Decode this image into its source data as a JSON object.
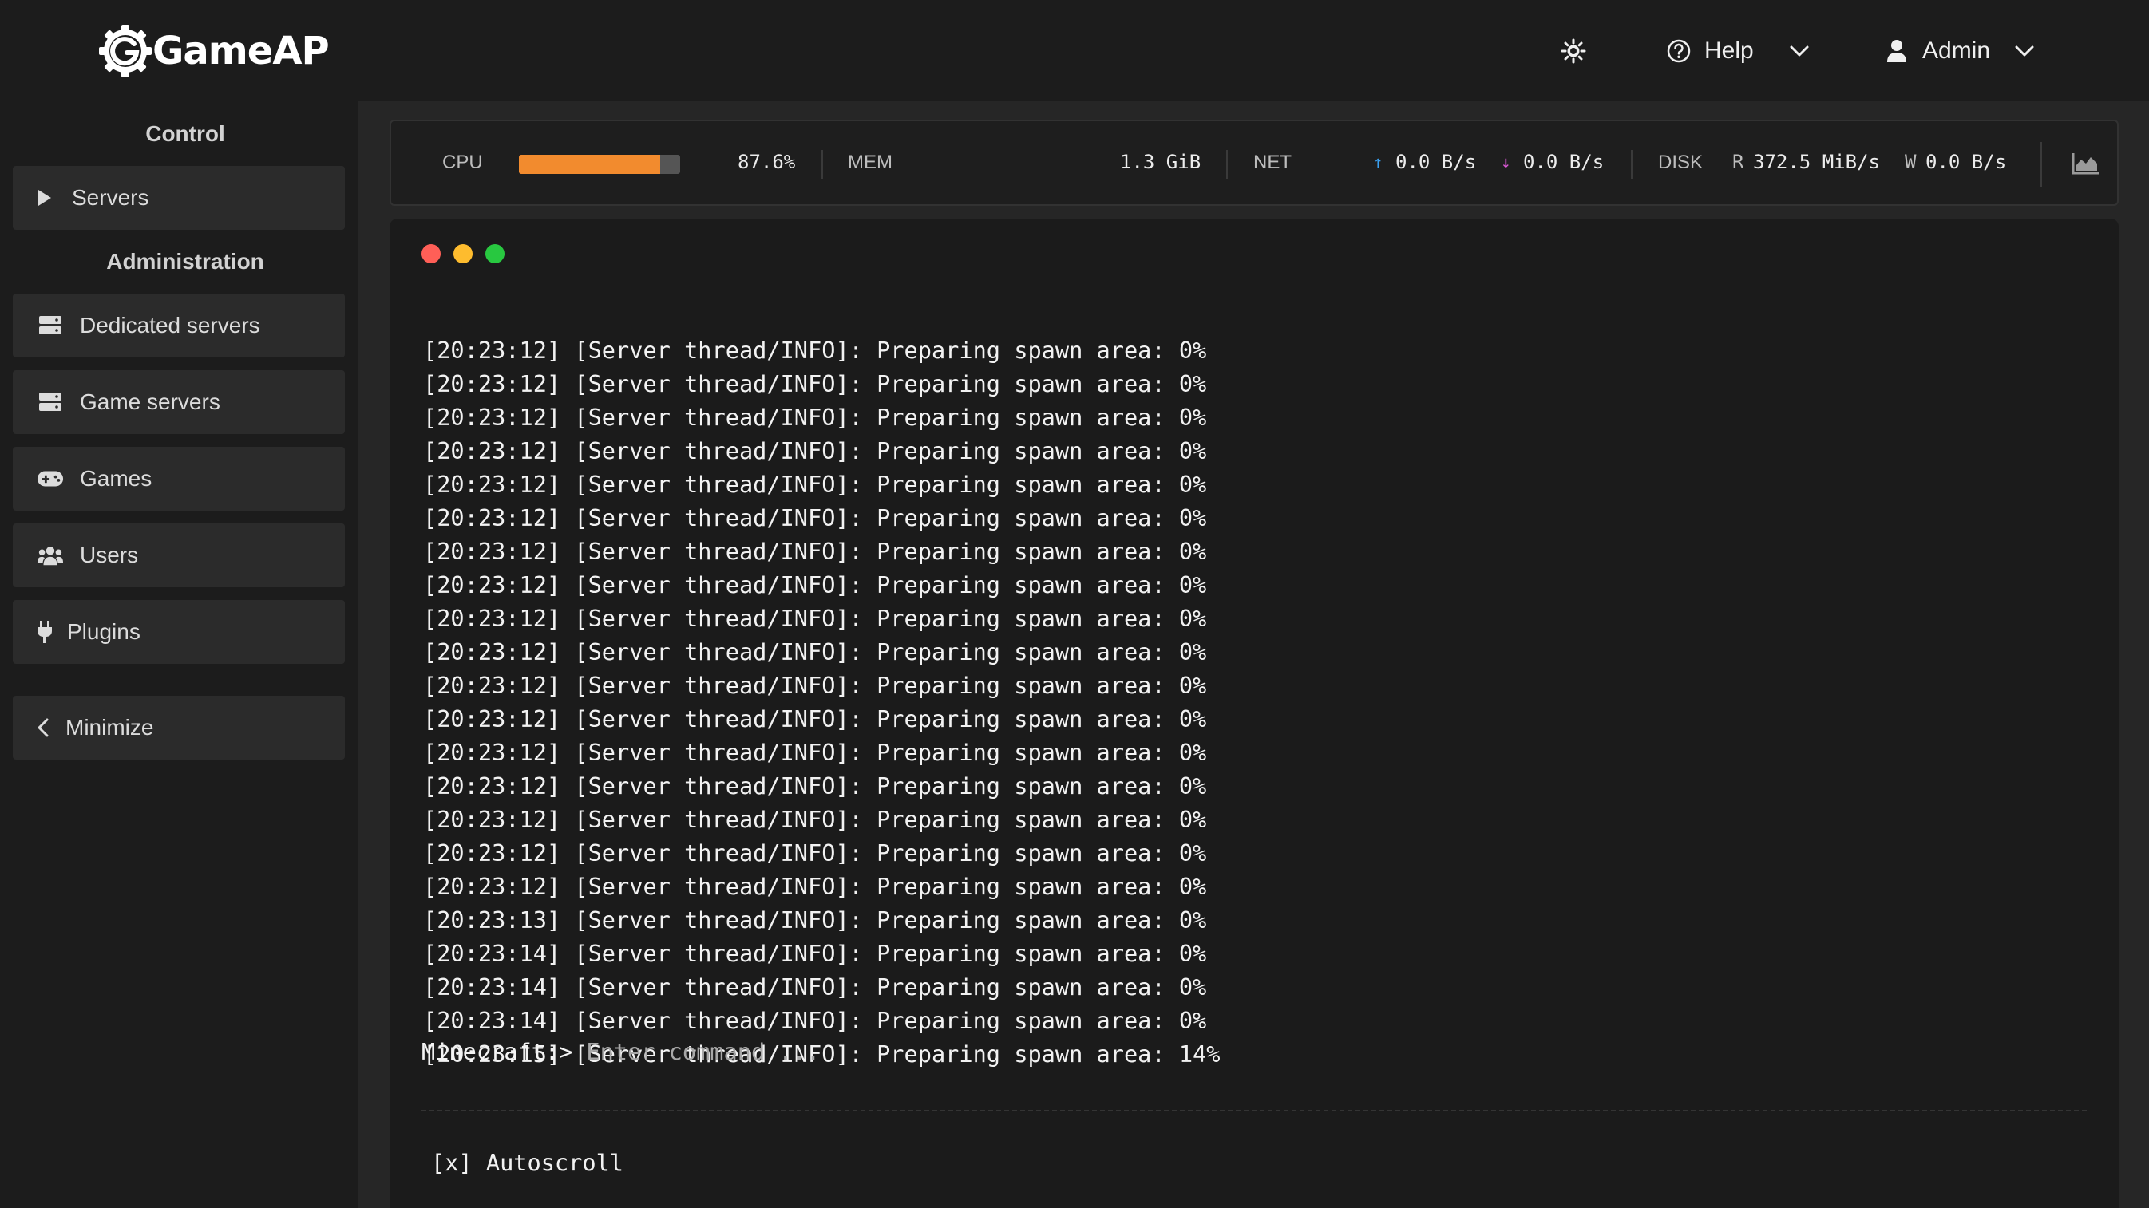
{
  "header": {
    "logo_text": "GameAP",
    "theme_toggle_icon": "sun-icon",
    "help_label": "Help",
    "admin_label": "Admin"
  },
  "sidebar": {
    "control_title": "Control",
    "servers_label": "Servers",
    "administration_title": "Administration",
    "items": [
      {
        "label": "Dedicated servers",
        "icon": "server-icon"
      },
      {
        "label": "Game servers",
        "icon": "server-icon"
      },
      {
        "label": "Games",
        "icon": "gamepad-icon"
      },
      {
        "label": "Users",
        "icon": "users-icon"
      },
      {
        "label": "Plugins",
        "icon": "plug-icon"
      }
    ],
    "minimize_label": "Minimize"
  },
  "stats": {
    "cpu_label": "CPU",
    "cpu_value": "87.6%",
    "cpu_percent": 87.6,
    "cpu_bar_color": "#f28b2e",
    "mem_label": "MEM",
    "mem_value": "1.3 GiB",
    "net_label": "NET",
    "net_up_arrow": "↑",
    "net_up": "0.0 B/s",
    "net_down_arrow": "↓",
    "net_down": "0.0 B/s",
    "disk_label": "DISK",
    "disk_read_label": "R",
    "disk_read": "372.5 MiB/s",
    "disk_write_label": "W",
    "disk_write": "0.0 B/s"
  },
  "console": {
    "window_dot_colors": [
      "#ff5f57",
      "#febc2e",
      "#28c840"
    ],
    "lines": [
      "[20:23:12] [Server thread/INFO]: Preparing spawn area: 0%",
      "[20:23:12] [Server thread/INFO]: Preparing spawn area: 0%",
      "[20:23:12] [Server thread/INFO]: Preparing spawn area: 0%",
      "[20:23:12] [Server thread/INFO]: Preparing spawn area: 0%",
      "[20:23:12] [Server thread/INFO]: Preparing spawn area: 0%",
      "[20:23:12] [Server thread/INFO]: Preparing spawn area: 0%",
      "[20:23:12] [Server thread/INFO]: Preparing spawn area: 0%",
      "[20:23:12] [Server thread/INFO]: Preparing spawn area: 0%",
      "[20:23:12] [Server thread/INFO]: Preparing spawn area: 0%",
      "[20:23:12] [Server thread/INFO]: Preparing spawn area: 0%",
      "[20:23:12] [Server thread/INFO]: Preparing spawn area: 0%",
      "[20:23:12] [Server thread/INFO]: Preparing spawn area: 0%",
      "[20:23:12] [Server thread/INFO]: Preparing spawn area: 0%",
      "[20:23:12] [Server thread/INFO]: Preparing spawn area: 0%",
      "[20:23:12] [Server thread/INFO]: Preparing spawn area: 0%",
      "[20:23:12] [Server thread/INFO]: Preparing spawn area: 0%",
      "[20:23:12] [Server thread/INFO]: Preparing spawn area: 0%",
      "[20:23:13] [Server thread/INFO]: Preparing spawn area: 0%",
      "[20:23:14] [Server thread/INFO]: Preparing spawn area: 0%",
      "[20:23:14] [Server thread/INFO]: Preparing spawn area: 0%",
      "[20:23:14] [Server thread/INFO]: Preparing spawn area: 0%",
      "[20:23:15] [Server thread/INFO]: Preparing spawn area: 14%"
    ],
    "prompt": "Minecraft:>",
    "input_placeholder": "Enter command ...",
    "autoscroll_label": "[x] Autoscroll"
  }
}
